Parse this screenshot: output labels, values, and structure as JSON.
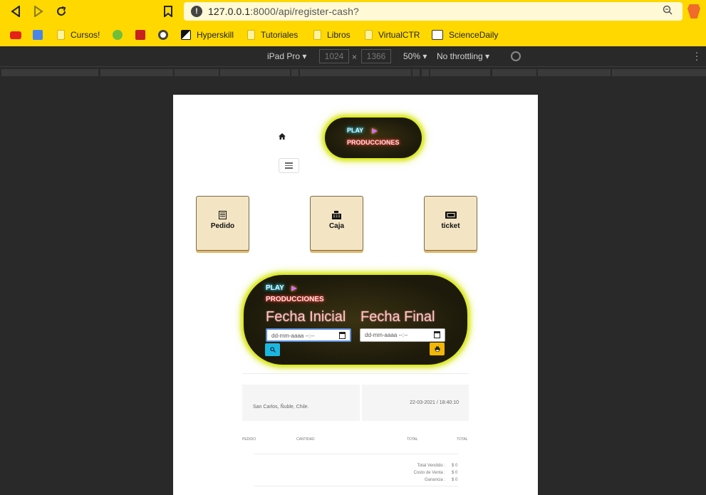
{
  "browser": {
    "url_host": "127.0.0.1",
    "url_rest": ":8000/api/register-cash?",
    "bookmarks": [
      "Cursos!",
      "Hyperskill",
      "Tutoriales",
      "Libros",
      "VirtualCTR",
      "ScienceDaily"
    ]
  },
  "devtools": {
    "device": "iPad Pro",
    "width": "1024",
    "height": "1366",
    "zoom": "50%",
    "throttling": "No throttling"
  },
  "page": {
    "logo_play": "PLAY",
    "logo_producciones": "PRODUCCIONES",
    "tiles": [
      {
        "label": "Pedido",
        "icon": "list-icon"
      },
      {
        "label": "Caja",
        "icon": "cash-register-icon"
      },
      {
        "label": "ticket",
        "icon": "ticket-icon"
      }
    ],
    "filter": {
      "fecha_inicial": "Fecha Inicial",
      "fecha_final": "Fecha Final",
      "date_placeholder": "dd-mm-aaaa --:--"
    },
    "report": {
      "location": "San Carlos, Ñuble, Chile.",
      "datetime": "22-03-2021 / 18:40:10",
      "columns": [
        "PEDIDO",
        "CANTIDAD",
        "TOTAL",
        "TOTAL"
      ],
      "totals": [
        {
          "label": "Total Vendido :",
          "value": "$ 0"
        },
        {
          "label": "Costo de Venta :",
          "value": "$ 0"
        },
        {
          "label": "Ganancia :",
          "value": "$ 0"
        }
      ]
    }
  }
}
